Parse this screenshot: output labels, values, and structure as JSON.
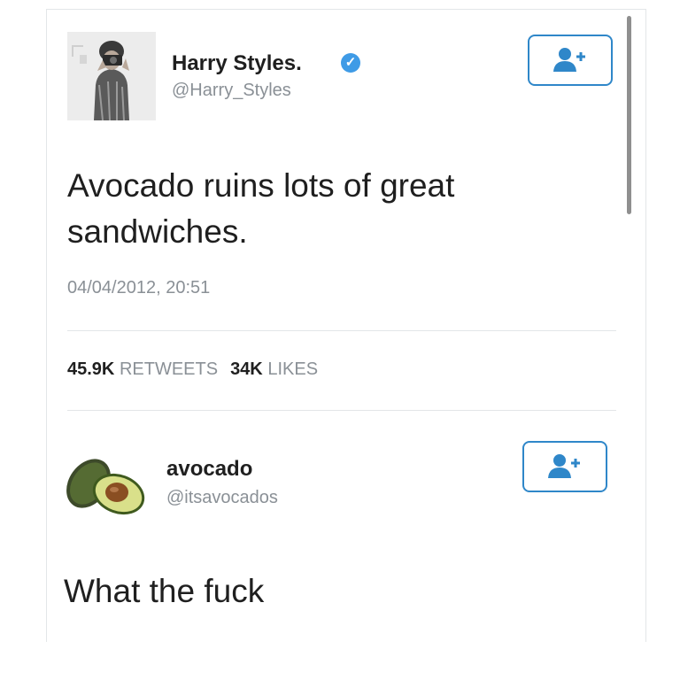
{
  "tweet": {
    "author_name": "Harry Styles.",
    "author_handle": "@Harry_Styles",
    "text": "Avocado ruins lots of great sandwiches.",
    "timestamp": "04/04/2012, 20:51",
    "retweets_count": "45.9K",
    "retweets_label": "RETWEETS",
    "likes_count": "34K",
    "likes_label": "LIKES"
  },
  "reply": {
    "author_name": "avocado",
    "author_handle": "@itsavocados",
    "text": "What the fuck"
  },
  "icons": {
    "verified": "verified-badge-icon",
    "follow": "add-user-icon"
  },
  "colors": {
    "accent": "#2f87c9",
    "verified": "#3f9be6",
    "muted_text": "#8a9096"
  }
}
